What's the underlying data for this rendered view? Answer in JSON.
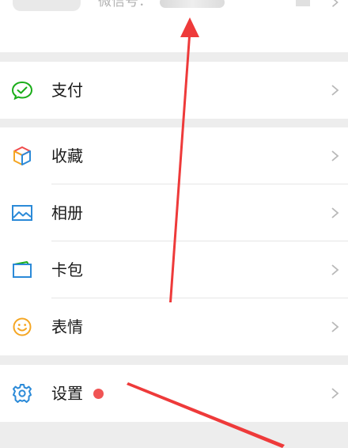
{
  "profile": {
    "wechat_id_label": "微信号："
  },
  "groups": [
    {
      "items": [
        {
          "id": "pay",
          "label": "支付",
          "icon": "wechat-pay-icon",
          "color": "#1aad19"
        }
      ]
    },
    {
      "items": [
        {
          "id": "favorites",
          "label": "收藏",
          "icon": "cube-icon",
          "color": "#f5a623"
        },
        {
          "id": "album",
          "label": "相册",
          "icon": "photo-icon",
          "color": "#2b8ad8"
        },
        {
          "id": "cards",
          "label": "卡包",
          "icon": "card-icon",
          "color": "#2b8ad8"
        },
        {
          "id": "stickers",
          "label": "表情",
          "icon": "smiley-icon",
          "color": "#f5a623"
        }
      ]
    },
    {
      "items": [
        {
          "id": "settings",
          "label": "设置",
          "icon": "gear-icon",
          "color": "#2b8ad8",
          "badge": true
        }
      ]
    }
  ],
  "annotation": {
    "arrow_color": "#ee3a3a"
  }
}
